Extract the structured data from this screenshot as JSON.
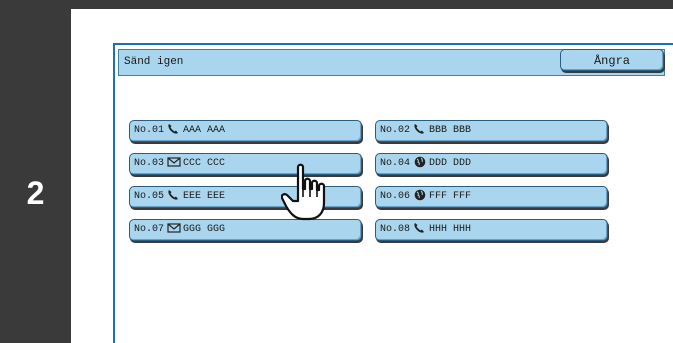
{
  "step": {
    "number": "2"
  },
  "header": {
    "title": "Sänd igen",
    "undo_label": "Ångra"
  },
  "destinations": [
    {
      "number": "No.01",
      "icon": "phone-icon",
      "name": "AAA AAA"
    },
    {
      "number": "No.02",
      "icon": "phone-icon",
      "name": "BBB BBB"
    },
    {
      "number": "No.03",
      "icon": "envelope-icon",
      "name": "CCC CCC"
    },
    {
      "number": "No.04",
      "icon": "globe-icon",
      "name": "DDD DDD"
    },
    {
      "number": "No.05",
      "icon": "phone-icon",
      "name": "EEE EEE"
    },
    {
      "number": "No.06",
      "icon": "globe-icon",
      "name": "FFF FFF"
    },
    {
      "number": "No.07",
      "icon": "envelope-icon",
      "name": "GGG GGG"
    },
    {
      "number": "No.08",
      "icon": "phone-icon",
      "name": "HHH HHH"
    }
  ],
  "colors": {
    "button": "#a9d6ee",
    "panel_border": "#1d6fb8",
    "step_bar": "#3a3a3a"
  }
}
